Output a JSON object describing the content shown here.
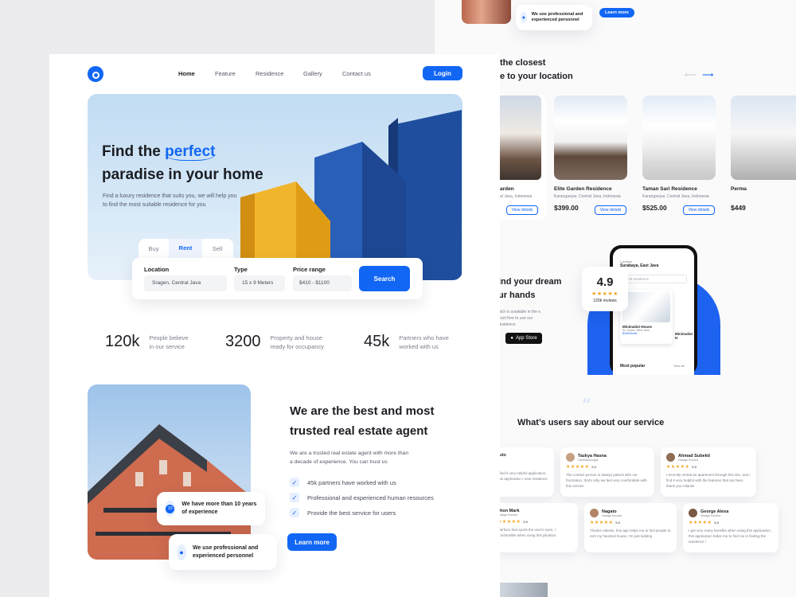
{
  "nav": {
    "links": [
      "Home",
      "Feature",
      "Residence",
      "Gallery",
      "Contact us"
    ],
    "login": "Login"
  },
  "hero": {
    "title_a": "Find the ",
    "title_highlight": "perfect",
    "title_b": "paradise in your home",
    "subtitle": "Find a luxury residence that suits you, we will help you to find the most suitable residence for you"
  },
  "search": {
    "tabs": [
      "Buy",
      "Rent",
      "Sell"
    ],
    "location_label": "Location",
    "location_value": "Sragen, Central Java",
    "type_label": "Type",
    "type_value": "15 x 9 Meters",
    "price_label": "Price range",
    "price_value": "$410 - $1100",
    "button": "Search"
  },
  "stats": [
    {
      "value": "120k",
      "text_a": "People believe",
      "text_b": "in our service"
    },
    {
      "value": "3200",
      "text_a": "Property and house",
      "text_b": "ready for occupancy"
    },
    {
      "value": "45k",
      "text_a": "Partners who have",
      "text_b": "worked with us"
    }
  ],
  "about": {
    "title_a": "We are the best and most",
    "title_b": "trusted real estate agent",
    "desc": "We are a trusted real estate agent with more than a decade of experience. You can trust us",
    "features": [
      "45k partners have worked with us",
      "Professional and experienced human resources",
      "Provide the best service for users"
    ],
    "button": "Learn more",
    "badge1": "We have more than 10 years of experience",
    "badge2": "We use professional and experienced personnel"
  },
  "back_top": {
    "badge": "We use professional and experienced personnel",
    "button": "Learn more"
  },
  "closest": {
    "title_a": "the closest",
    "title_b": "e to your location",
    "cards": [
      {
        "name": "arden",
        "loc": "al Java, Indonesia",
        "price": "",
        "btn": "View details"
      },
      {
        "name": "Elite Garden Residence",
        "loc": "Karanganyar, Central Java, Indonesia",
        "price": "$399.00",
        "btn": "View details"
      },
      {
        "name": "Taman Sari Residence",
        "loc": "Karanganyar, Central Java, Indonesia",
        "price": "$525.00",
        "btn": "View details"
      },
      {
        "name": "Perma",
        "loc": "",
        "price": "$449",
        "btn": ""
      }
    ]
  },
  "app": {
    "title_a": "ind your dream",
    "title_b": "ur hands",
    "desc": "hich is available in the e. Feel free to use our residence",
    "store": "App Store",
    "rating": "4.9",
    "reviews": "120k reviews",
    "phone_loc_label": "Location",
    "phone_loc": "Surabaya, East Java",
    "phone_search": "earch residence",
    "phone_card1": "Minimalist House",
    "phone_card1_loc": "St. Depok, West Java",
    "phone_card1_price": "$340/month",
    "phone_card2": "Minimalist H",
    "phone_popular": "Most popular",
    "phone_viewall": "View all"
  },
  "testimonials": {
    "title": "What’s users say about our service",
    "row1": [
      {
        "name": "ruto",
        "role": "",
        "score": "",
        "text": "I find it very helpful application, this application r new residence"
      },
      {
        "name": "Tazkya Hasna",
        "role": "Ophthalmologist",
        "score": "5.0",
        "text": "The contact person is always patient with our frustration, that's why we feel very comfortable with this service"
      },
      {
        "name": "Ahmad Subekti",
        "role": "Hokage Konoha",
        "score": "5.0",
        "text": "I recently rented an apartment through this site, and I find it very helpful with the features that are here, thank you Atlantis"
      }
    ],
    "row2": [
      {
        "name": "Jhon Mark",
        "role": "Hokage Konoha",
        "score": "5.0",
        "text": "nterface that spoils the user's eyes, I comfortable when using this plication"
      },
      {
        "name": "Nagato",
        "role": "Hokage Konoha",
        "score": "5.0",
        "text": "Thanks Atlantis, this app helps me to find people to rent my haunted house, I'm just kidding"
      },
      {
        "name": "George Alexa",
        "role": "Hokage Konoha",
        "score": "5.0",
        "text": "I get very many benefits when using this application, this application helps me to find me in finding the residence i"
      }
    ]
  },
  "colors": {
    "accent": "#1166f4",
    "text": "#1b1d22",
    "muted": "#7a7f8a",
    "star": "#f5a623"
  }
}
